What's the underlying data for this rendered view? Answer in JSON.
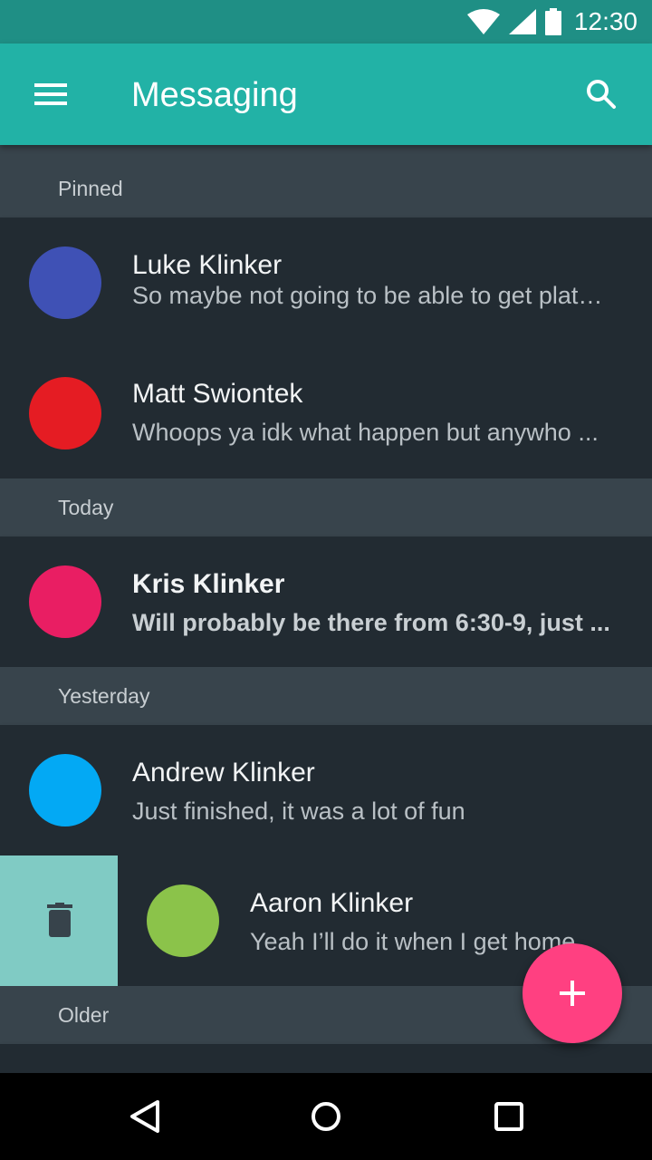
{
  "status_bar": {
    "time": "12:30",
    "icons": [
      "wifi-icon",
      "signal-icon",
      "battery-icon"
    ]
  },
  "app_bar": {
    "title": "Messaging",
    "menu_icon": "menu-icon",
    "search_icon": "search-icon"
  },
  "colors": {
    "primary": "#22b2a6",
    "primary_dark": "#1f8f85",
    "accent": "#ff4081",
    "background": "#37434b",
    "card": "#222b32",
    "swipe_delete": "#80cbc4"
  },
  "sections": {
    "pinned": "Pinned",
    "today": "Today",
    "yesterday": "Yesterday",
    "older": "Older"
  },
  "conversations": [
    {
      "name": "Luke Klinker",
      "snippet": "So maybe not going to be able to get plat…",
      "avatar_color": "#3f51b5",
      "unread": false
    },
    {
      "name": "Matt Swiontek",
      "snippet": "Whoops ya idk what happen but anywho ...",
      "avatar_color": "#e51c23",
      "unread": false
    },
    {
      "name": "Kris Klinker",
      "snippet": "Will probably be there from 6:30-9, just ...",
      "avatar_color": "#e91e63",
      "unread": true
    },
    {
      "name": "Andrew Klinker",
      "snippet": "Just finished, it was a lot of fun",
      "avatar_color": "#03a9f4",
      "unread": false
    },
    {
      "name": "Aaron Klinker",
      "snippet": "Yeah I’ll do it when I get home",
      "avatar_color": "#8bc34a",
      "unread": false
    }
  ],
  "swipe_action": {
    "icon": "trash-icon"
  },
  "fab": {
    "icon": "plus-icon"
  },
  "nav_bar": {
    "back": "back-icon",
    "home": "home-icon",
    "recents": "recents-icon"
  }
}
